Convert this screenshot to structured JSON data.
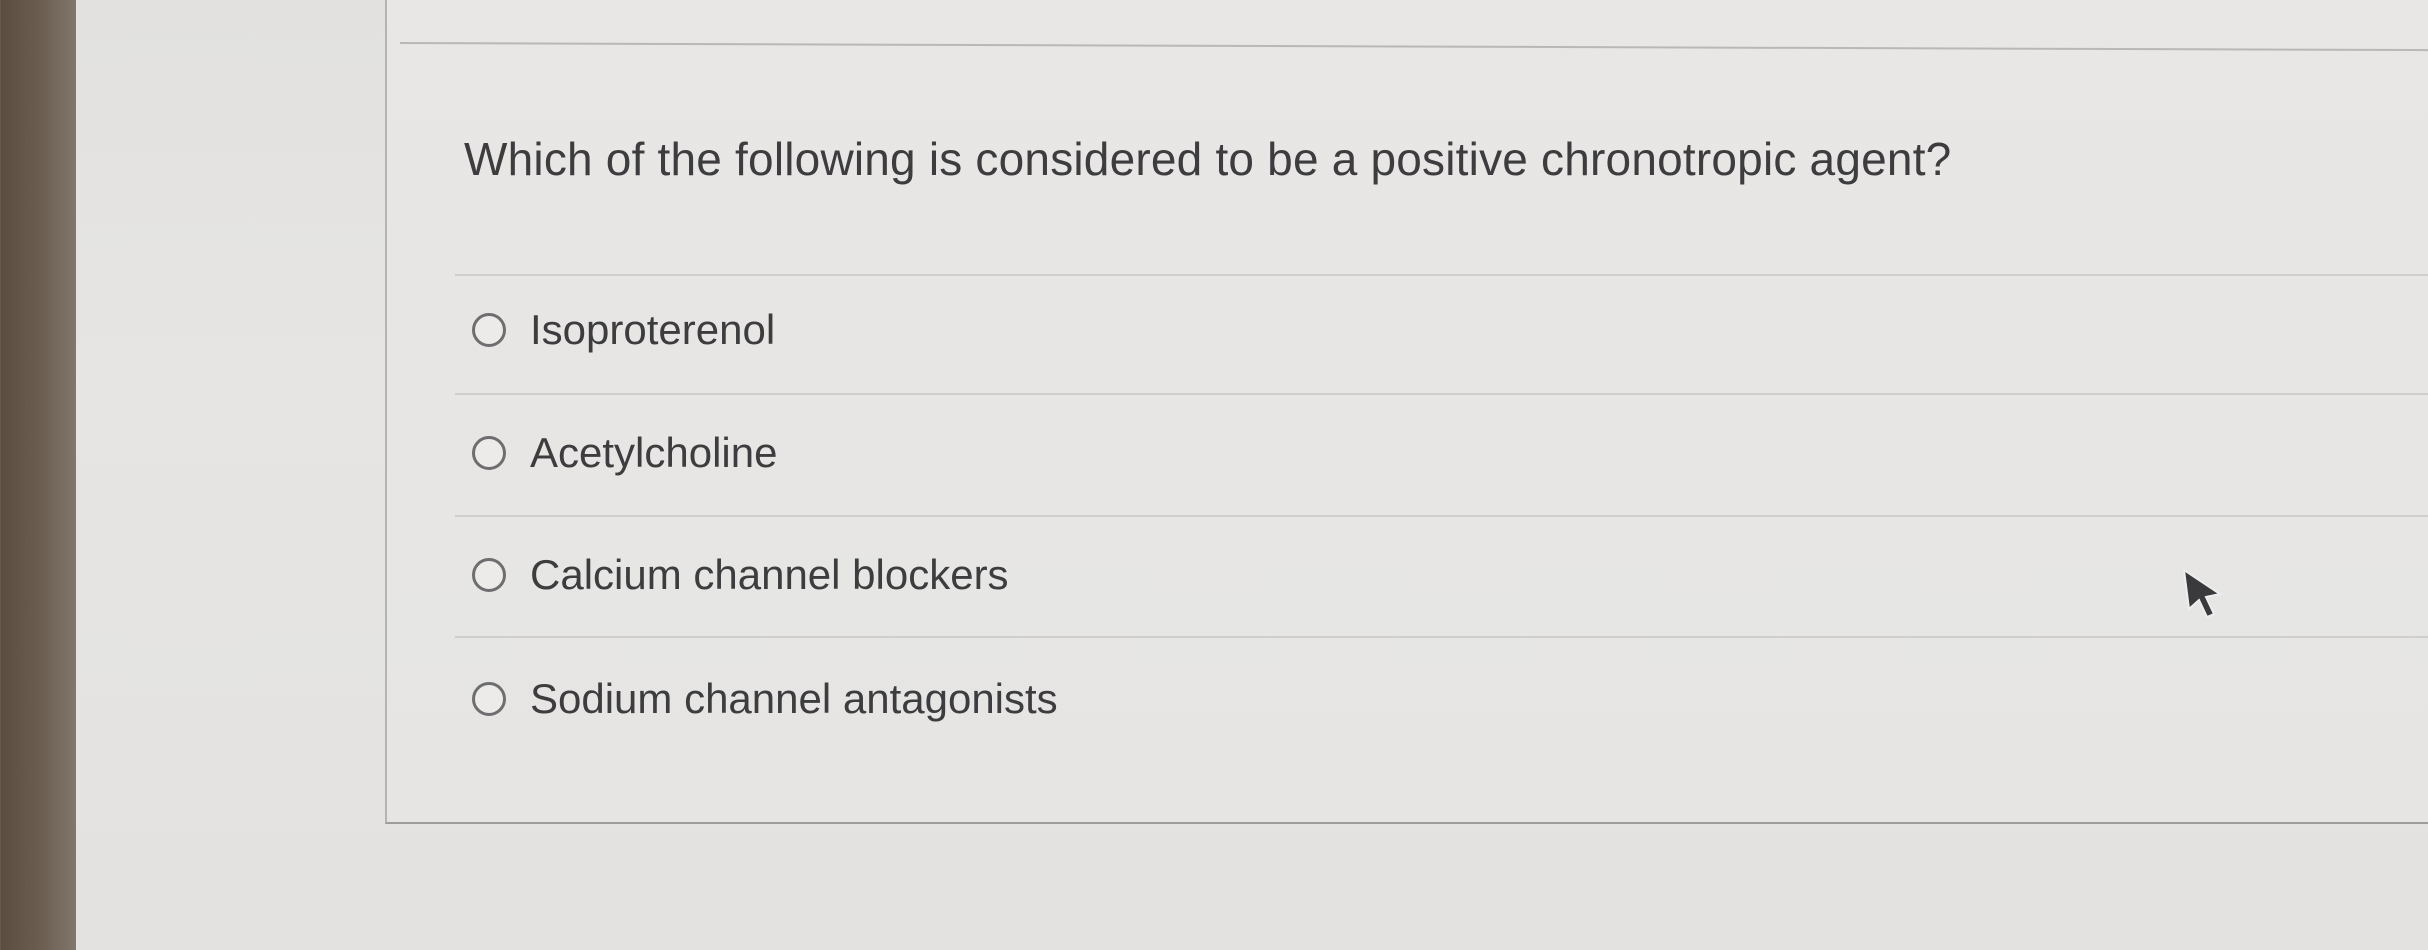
{
  "quiz": {
    "question": "Which of the following is considered to be a positive chronotropic agent?",
    "options": [
      {
        "label": "Isoproterenol",
        "selected": false
      },
      {
        "label": "Acetylcholine",
        "selected": false
      },
      {
        "label": "Calcium channel blockers",
        "selected": false
      },
      {
        "label": "Sodium channel antagonists",
        "selected": false
      }
    ]
  },
  "icons": {
    "radio": "radio-button-icon",
    "cursor": "mouse-pointer-icon"
  },
  "colors": {
    "text": "#3d3d3f",
    "background": "#e6e5e3",
    "divider": "#cfcecc"
  }
}
